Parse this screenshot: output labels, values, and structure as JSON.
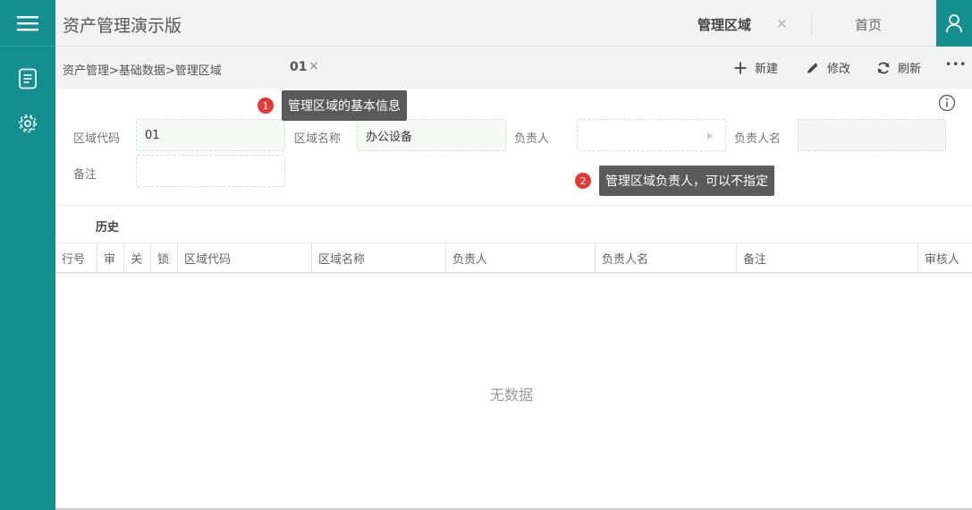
{
  "app": {
    "title": "资产管理演示版"
  },
  "tabs": {
    "active_label": "管理区域",
    "close_glyph": "×",
    "home_label": "首页"
  },
  "sidebar": {
    "menu_icon": "menu-icon",
    "items": [
      {
        "icon": "document-icon"
      },
      {
        "icon": "settings-icon"
      }
    ]
  },
  "toolbar": {
    "breadcrumb": "资产管理>基础数据>管理区域",
    "record_id": "01",
    "record_close": "×",
    "new_label": "新建",
    "edit_label": "修改",
    "refresh_label": "刷新",
    "more_glyph": "•••"
  },
  "form": {
    "code_label": "区域代码",
    "code_value": "01",
    "name_label": "区域名称",
    "name_value": "办公设备",
    "owner_label": "负责人",
    "owner_value": "",
    "owner_name_label": "负责人名",
    "owner_name_value": "",
    "remark_label": "备注",
    "remark_value": ""
  },
  "tips": [
    {
      "num": "1",
      "text": "管理区域的基本信息"
    },
    {
      "num": "2",
      "text": "管理区域负责人，可以不指定"
    }
  ],
  "history": {
    "title": "历史",
    "columns": [
      "行号",
      "审",
      "关",
      "锁",
      "区域代码",
      "区域名称",
      "负责人",
      "负责人名",
      "备注",
      "审核人"
    ],
    "empty_text": "无数据"
  },
  "colors": {
    "accent": "#138f8f",
    "badge": "#e53935",
    "tooltip": "#5a5a5a"
  }
}
